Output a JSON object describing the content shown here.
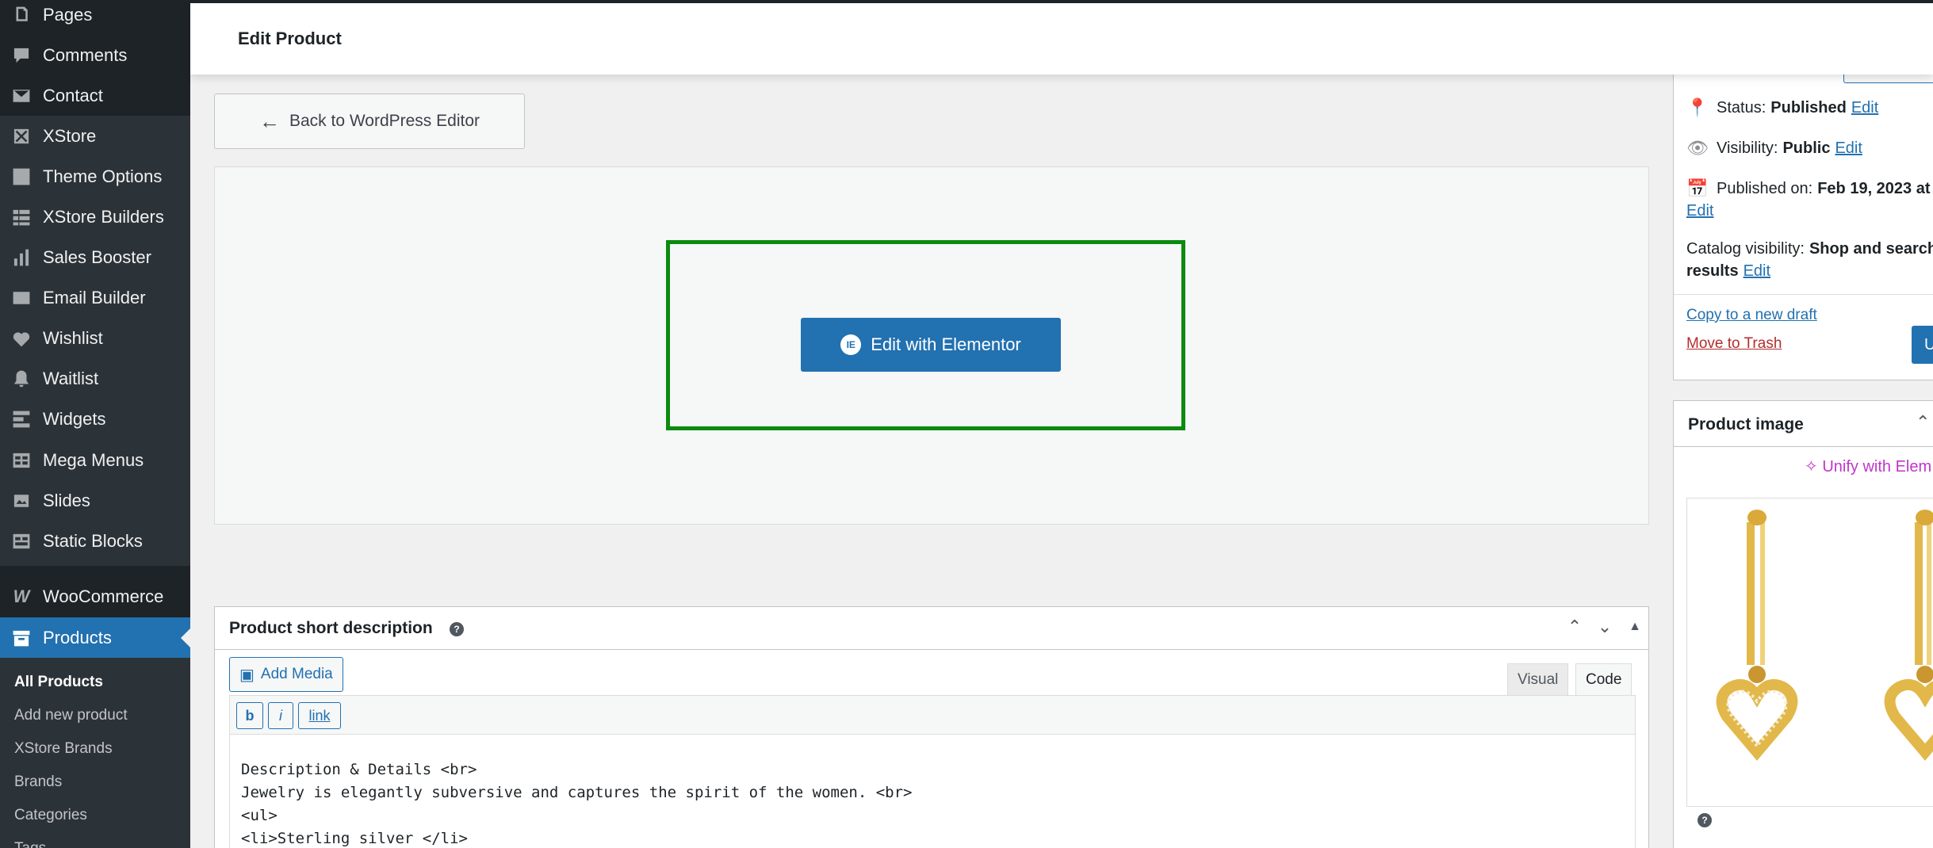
{
  "sidebar": {
    "items": [
      {
        "label": "Pages",
        "icon": "pages-icon"
      },
      {
        "label": "Comments",
        "icon": "comments-icon"
      },
      {
        "label": "Contact",
        "icon": "mail-icon"
      },
      {
        "label": "XStore",
        "icon": "xstore-icon"
      },
      {
        "label": "Theme Options",
        "icon": "theme-options-icon"
      },
      {
        "label": "XStore Builders",
        "icon": "builders-icon"
      },
      {
        "label": "Sales Booster",
        "icon": "chart-icon"
      },
      {
        "label": "Email Builder",
        "icon": "mail-icon"
      },
      {
        "label": "Wishlist",
        "icon": "heart-icon"
      },
      {
        "label": "Waitlist",
        "icon": "bell-icon"
      },
      {
        "label": "Widgets",
        "icon": "widgets-icon"
      },
      {
        "label": "Mega Menus",
        "icon": "grid-icon"
      },
      {
        "label": "Slides",
        "icon": "slides-icon"
      },
      {
        "label": "Static Blocks",
        "icon": "blocks-icon"
      },
      {
        "label": "WooCommerce",
        "icon": "woocommerce-icon"
      },
      {
        "label": "Products",
        "icon": "archive-icon"
      }
    ],
    "submenu": [
      "All Products",
      "Add new product",
      "XStore Brands",
      "Brands",
      "Categories",
      "Tags"
    ]
  },
  "header": {
    "title": "Edit Product"
  },
  "main": {
    "back_label": "Back to WordPress Editor",
    "elementor_label": "Edit with Elementor"
  },
  "short_description": {
    "title": "Product short description",
    "add_media": "Add Media",
    "tab_visual": "Visual",
    "tab_code": "Code",
    "qt_bold": "b",
    "qt_italic": "i",
    "qt_link": "link",
    "content": "Description & Details <br>\nJewelry is elegantly subversive and captures the spirit of the women. <br>\n<ul>\n<li>Sterling silver </li>"
  },
  "publish": {
    "status_label": "Status:",
    "status_value": "Published",
    "visibility_label": "Visibility:",
    "visibility_value": "Public",
    "published_label": "Published on:",
    "published_value": "Feb 19, 2023 at",
    "catalog_label": "Catalog visibility:",
    "catalog_value": "Shop and search",
    "catalog_value2": "results",
    "edit": "Edit",
    "copy_draft": "Copy to a new draft",
    "trash": "Move to Trash",
    "update_label": "U"
  },
  "product_image": {
    "title": "Product image",
    "unify": "Unify with Elem"
  },
  "colors": {
    "sidebar_bg": "#1d2327",
    "accent": "#2271b1",
    "highlight": "#0b8a0f",
    "trash": "#b32d2e",
    "unify": "#c036c9"
  }
}
